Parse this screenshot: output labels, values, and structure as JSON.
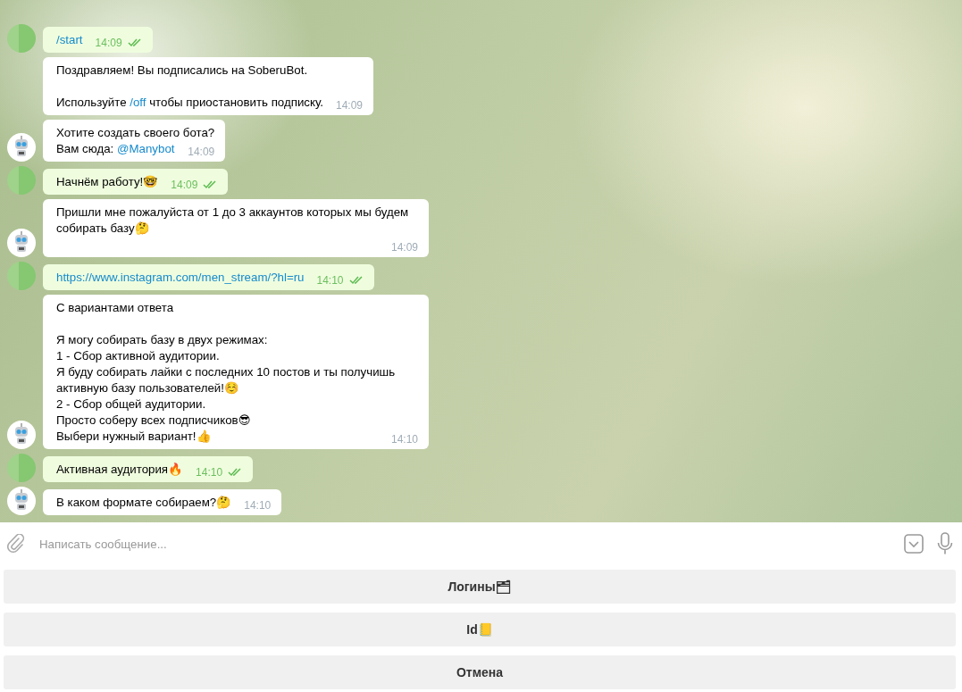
{
  "messages": [
    {
      "kind": "out",
      "avatar": true,
      "read": true,
      "time": "14:09",
      "lines": [
        {
          "parts": [
            {
              "kind": "link",
              "text": "/start"
            }
          ]
        }
      ]
    },
    {
      "kind": "in",
      "avatar": false,
      "time": "14:09",
      "lines": [
        {
          "parts": [
            {
              "kind": "text",
              "text": "Поздравляем! Вы подписались на SoberuBot."
            }
          ]
        },
        {
          "space_before": true,
          "parts": [
            {
              "kind": "text",
              "text": "Используйте "
            },
            {
              "kind": "link",
              "text": "/off"
            },
            {
              "kind": "text",
              "text": " чтобы приостановить подписку."
            }
          ]
        }
      ]
    },
    {
      "kind": "in",
      "avatar": true,
      "time": "14:09",
      "lines": [
        {
          "parts": [
            {
              "kind": "text",
              "text": "Хотите создать своего бота?"
            }
          ]
        },
        {
          "parts": [
            {
              "kind": "text",
              "text": "Вам сюда: "
            },
            {
              "kind": "link",
              "text": "@Manybot"
            }
          ]
        }
      ]
    },
    {
      "kind": "out",
      "avatar": true,
      "read": true,
      "time": "14:09",
      "lines": [
        {
          "parts": [
            {
              "kind": "text",
              "text": "Начнём работу!🤓"
            }
          ]
        }
      ]
    },
    {
      "kind": "in",
      "avatar": true,
      "time": "14:09",
      "lines": [
        {
          "parts": [
            {
              "kind": "text",
              "text": "Пришли мне пожалуйста от 1 до 3 аккаунтов которых мы будем собирать базу🤔"
            }
          ]
        }
      ]
    },
    {
      "kind": "out",
      "avatar": true,
      "read": true,
      "time": "14:10",
      "lines": [
        {
          "parts": [
            {
              "kind": "link",
              "text": "https://www.instagram.com/men_stream/?hl=ru"
            }
          ]
        }
      ]
    },
    {
      "kind": "in",
      "avatar": true,
      "time": "14:10",
      "lines": [
        {
          "parts": [
            {
              "kind": "text",
              "text": "С вариантами ответа"
            }
          ]
        },
        {
          "space_before": true,
          "parts": [
            {
              "kind": "text",
              "text": "Я могу собирать базу в двух режимах:"
            }
          ]
        },
        {
          "parts": [
            {
              "kind": "text",
              "text": "1 - Сбор активной аудитории."
            }
          ]
        },
        {
          "parts": [
            {
              "kind": "text",
              "text": "Я буду собирать лайки с последних 10 постов и ты получишь активную базу пользователей!☺️"
            }
          ]
        },
        {
          "parts": [
            {
              "kind": "text",
              "text": "2 - Сбор общей аудитории."
            }
          ]
        },
        {
          "parts": [
            {
              "kind": "text",
              "text": "Просто соберу всех подписчиков😎"
            }
          ]
        },
        {
          "parts": [
            {
              "kind": "text",
              "text": "Выбери нужный вариант!👍"
            }
          ]
        }
      ]
    },
    {
      "kind": "out",
      "avatar": true,
      "read": true,
      "time": "14:10",
      "lines": [
        {
          "parts": [
            {
              "kind": "text",
              "text": "Активная аудитория🔥"
            }
          ]
        }
      ]
    },
    {
      "kind": "in",
      "avatar": true,
      "time": "14:10",
      "lines": [
        {
          "parts": [
            {
              "kind": "text",
              "text": "В каком формате собираем?🤔"
            }
          ]
        }
      ]
    }
  ],
  "composer": {
    "placeholder": "Написать сообщение..."
  },
  "keyboard": [
    "Логины🗂",
    "Id📒",
    "Отмена"
  ]
}
